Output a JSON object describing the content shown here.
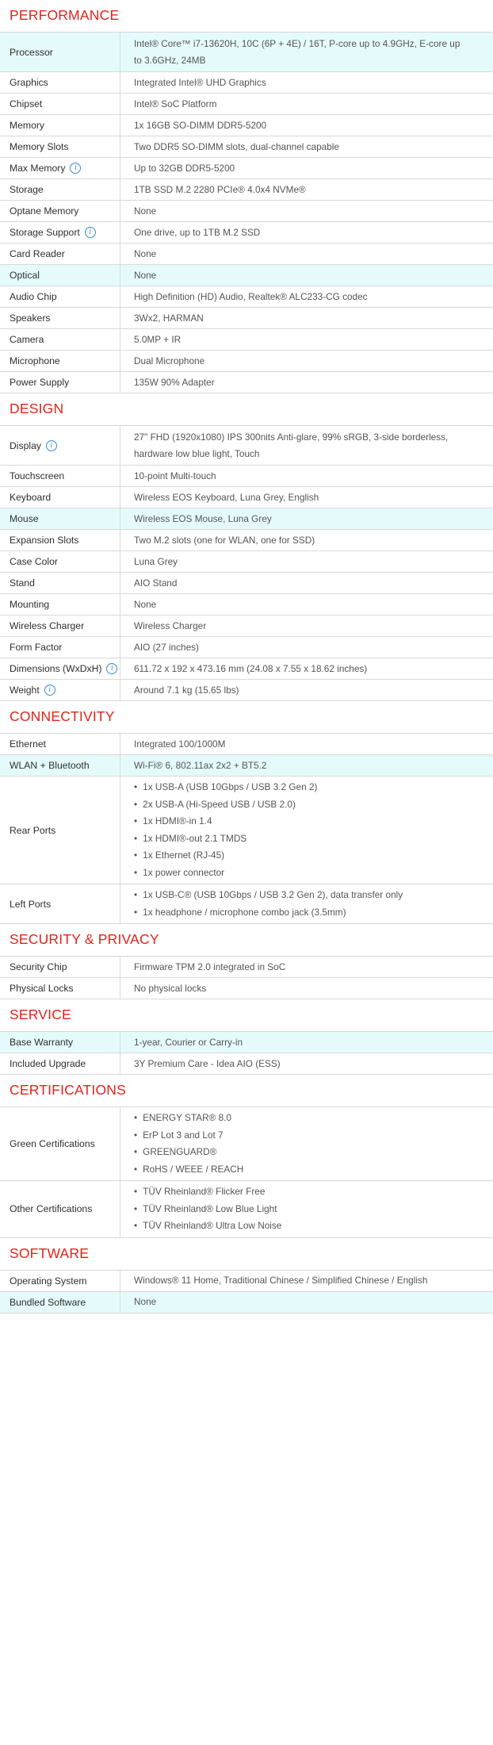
{
  "sections": [
    {
      "title": "PERFORMANCE",
      "rows": [
        {
          "label": "Processor",
          "lines": [
            "Intel® Core™ i7-13620H, 10C (6P + 4E) / 16T, P-core up to 4.9GHz, E-core up",
            "to 3.6GHz, 24MB"
          ],
          "highlight": true
        },
        {
          "label": "Graphics",
          "lines": [
            "Integrated Intel® UHD Graphics"
          ]
        },
        {
          "label": "Chipset",
          "lines": [
            "Intel® SoC Platform"
          ]
        },
        {
          "label": "Memory",
          "lines": [
            "1x 16GB SO-DIMM DDR5-5200"
          ]
        },
        {
          "label": "Memory Slots",
          "lines": [
            "Two DDR5 SO-DIMM slots, dual-channel capable"
          ]
        },
        {
          "label": "Max Memory",
          "info": true,
          "lines": [
            "Up to 32GB DDR5-5200"
          ]
        },
        {
          "label": "Storage",
          "lines": [
            "1TB SSD M.2 2280 PCIe® 4.0x4 NVMe®"
          ]
        },
        {
          "label": "Optane Memory",
          "lines": [
            "None"
          ]
        },
        {
          "label": "Storage Support",
          "info": true,
          "lines": [
            "One drive, up to 1TB M.2 SSD"
          ]
        },
        {
          "label": "Card Reader",
          "lines": [
            "None"
          ]
        },
        {
          "label": "Optical",
          "lines": [
            "None"
          ],
          "highlight": true
        },
        {
          "label": "Audio Chip",
          "lines": [
            "High Definition (HD) Audio, Realtek® ALC233-CG codec"
          ]
        },
        {
          "label": "Speakers",
          "lines": [
            "3Wx2, HARMAN"
          ]
        },
        {
          "label": "Camera",
          "lines": [
            "5.0MP + IR"
          ]
        },
        {
          "label": "Microphone",
          "lines": [
            "Dual Microphone"
          ]
        },
        {
          "label": "Power Supply",
          "lines": [
            "135W 90% Adapter"
          ]
        }
      ]
    },
    {
      "title": "DESIGN",
      "rows": [
        {
          "label": "Display",
          "info": true,
          "lines": [
            "27\" FHD (1920x1080) IPS 300nits Anti-glare, 99% sRGB, 3-side borderless,",
            "hardware low blue light, Touch"
          ]
        },
        {
          "label": "Touchscreen",
          "lines": [
            "10-point Multi-touch"
          ]
        },
        {
          "label": "Keyboard",
          "lines": [
            "Wireless EOS Keyboard, Luna Grey, English"
          ]
        },
        {
          "label": "Mouse",
          "lines": [
            "Wireless EOS Mouse, Luna Grey"
          ],
          "highlight": true
        },
        {
          "label": "Expansion Slots",
          "lines": [
            "Two M.2 slots (one for WLAN, one for SSD)"
          ]
        },
        {
          "label": "Case Color",
          "lines": [
            "Luna Grey"
          ]
        },
        {
          "label": "Stand",
          "lines": [
            "AIO Stand"
          ]
        },
        {
          "label": "Mounting",
          "lines": [
            "None"
          ]
        },
        {
          "label": "Wireless Charger",
          "lines": [
            "Wireless Charger"
          ]
        },
        {
          "label": "Form Factor",
          "lines": [
            "AIO (27 inches)"
          ]
        },
        {
          "label": "Dimensions (WxDxH)",
          "info": true,
          "lines": [
            "611.72 x 192 x 473.16 mm (24.08 x 7.55 x 18.62 inches)"
          ]
        },
        {
          "label": "Weight",
          "info": true,
          "lines": [
            "Around 7.1 kg (15.65 lbs)"
          ]
        }
      ]
    },
    {
      "title": "CONNECTIVITY",
      "rows": [
        {
          "label": "Ethernet",
          "lines": [
            "Integrated 100/1000M"
          ]
        },
        {
          "label": "WLAN + Bluetooth",
          "lines": [
            "Wi-Fi® 6, 802.11ax 2x2 + BT5.2"
          ],
          "highlight": true
        },
        {
          "label": "Rear Ports",
          "bullets": [
            "1x USB-A (USB 10Gbps / USB 3.2 Gen 2)",
            "2x USB-A (Hi-Speed USB / USB 2.0)",
            "1x HDMI®-in 1.4",
            "1x HDMI®-out 2.1 TMDS",
            "1x Ethernet (RJ-45)",
            "1x power connector"
          ]
        },
        {
          "label": "Left Ports",
          "bullets": [
            "1x USB-C® (USB 10Gbps / USB 3.2 Gen 2), data transfer only",
            "1x headphone / microphone combo jack (3.5mm)"
          ]
        }
      ]
    },
    {
      "title": "SECURITY & PRIVACY",
      "rows": [
        {
          "label": "Security Chip",
          "lines": [
            "Firmware TPM 2.0 integrated in SoC"
          ]
        },
        {
          "label": "Physical Locks",
          "lines": [
            "No physical locks"
          ]
        }
      ]
    },
    {
      "title": "SERVICE",
      "rows": [
        {
          "label": "Base Warranty",
          "lines": [
            "1-year, Courier or Carry-in"
          ],
          "highlight": true
        },
        {
          "label": "Included Upgrade",
          "lines": [
            "3Y Premium Care - Idea AIO (ESS)"
          ]
        }
      ]
    },
    {
      "title": "CERTIFICATIONS",
      "rows": [
        {
          "label": "Green Certifications",
          "bullets": [
            "ENERGY STAR® 8.0",
            "ErP Lot 3 and Lot 7",
            "GREENGUARD®",
            "RoHS / WEEE / REACH"
          ]
        },
        {
          "label": "Other Certifications",
          "bullets": [
            "TÜV Rheinland® Flicker Free",
            "TÜV Rheinland® Low Blue Light",
            "TÜV Rheinland® Ultra Low Noise"
          ]
        }
      ]
    },
    {
      "title": "SOFTWARE",
      "rows": [
        {
          "label": "Operating System",
          "lines": [
            "Windows® 11 Home, Traditional Chinese / Simplified Chinese / English"
          ]
        },
        {
          "label": "Bundled Software",
          "lines": [
            "None"
          ],
          "highlight": true
        }
      ]
    }
  ]
}
